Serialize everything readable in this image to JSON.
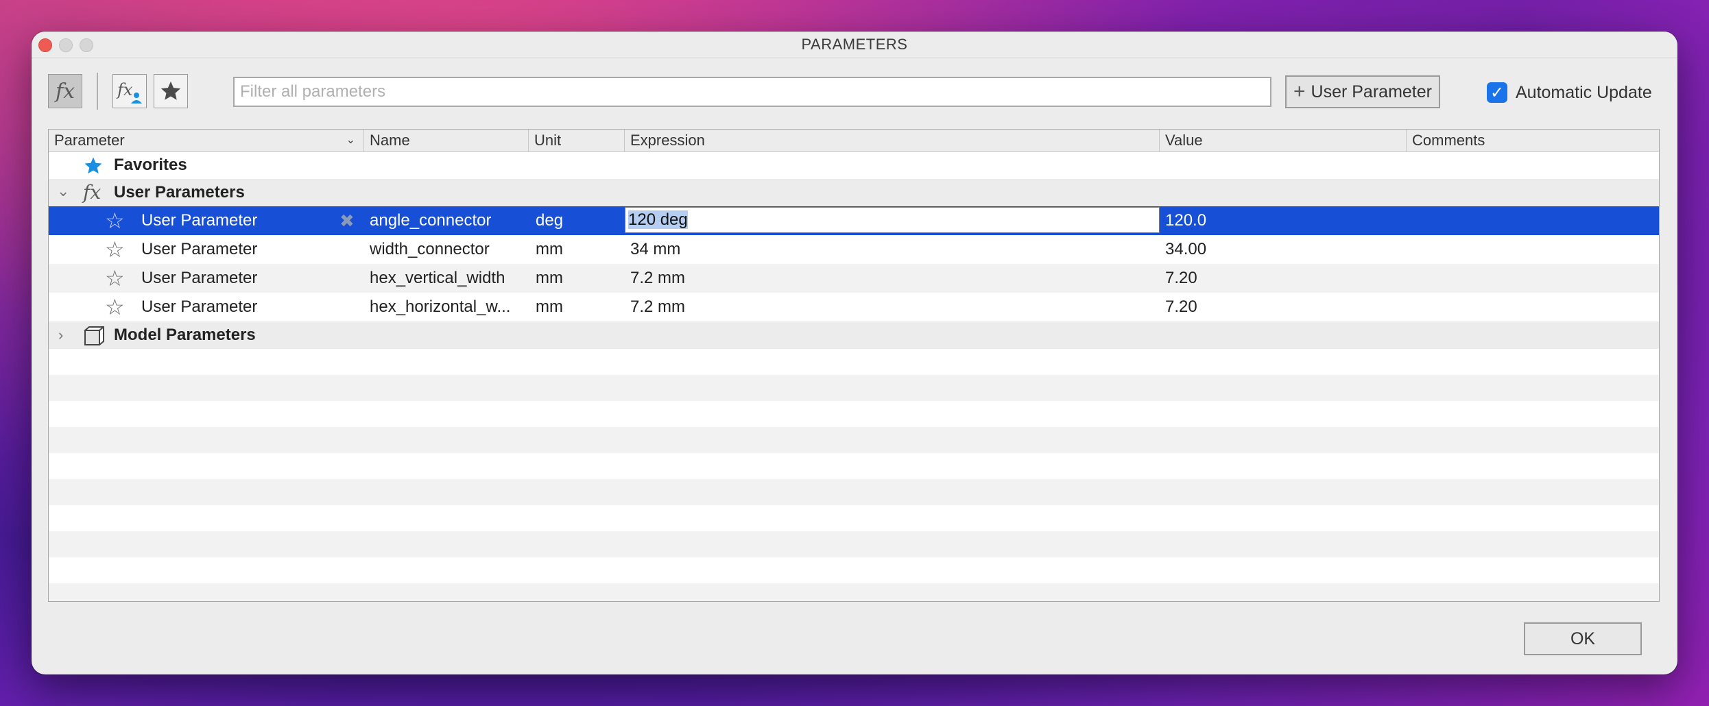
{
  "window": {
    "title": "PARAMETERS"
  },
  "toolbar": {
    "search_placeholder": "Filter all parameters",
    "add_user_parameter_label": "User Parameter",
    "automatic_update_label": "Automatic Update",
    "automatic_update_checked": true
  },
  "table": {
    "columns": {
      "parameter": "Parameter",
      "name": "Name",
      "unit": "Unit",
      "expression": "Expression",
      "value": "Value",
      "comments": "Comments"
    },
    "groups": {
      "favorites": "Favorites",
      "user_parameters": "User Parameters",
      "model_parameters": "Model Parameters"
    },
    "rows": [
      {
        "parameter": "User Parameter",
        "name": "angle_connector",
        "unit": "deg",
        "expression": "120 deg",
        "value": "120.0",
        "comments": "",
        "selected": true
      },
      {
        "parameter": "User Parameter",
        "name": "width_connector",
        "unit": "mm",
        "expression": "34 mm",
        "value": "34.00",
        "comments": "",
        "selected": false
      },
      {
        "parameter": "User Parameter",
        "name": "hex_vertical_width",
        "unit": "mm",
        "expression": "7.2 mm",
        "value": "7.20",
        "comments": "",
        "selected": false
      },
      {
        "parameter": "User Parameter",
        "name": "hex_horizontal_w...",
        "unit": "mm",
        "expression": "7.2 mm",
        "value": "7.20",
        "comments": "",
        "selected": false
      }
    ]
  },
  "footer": {
    "ok_label": "OK"
  },
  "colors": {
    "selection": "#1750d6",
    "favorite_star": "#1a8fe0",
    "checkbox": "#1a73e8"
  }
}
